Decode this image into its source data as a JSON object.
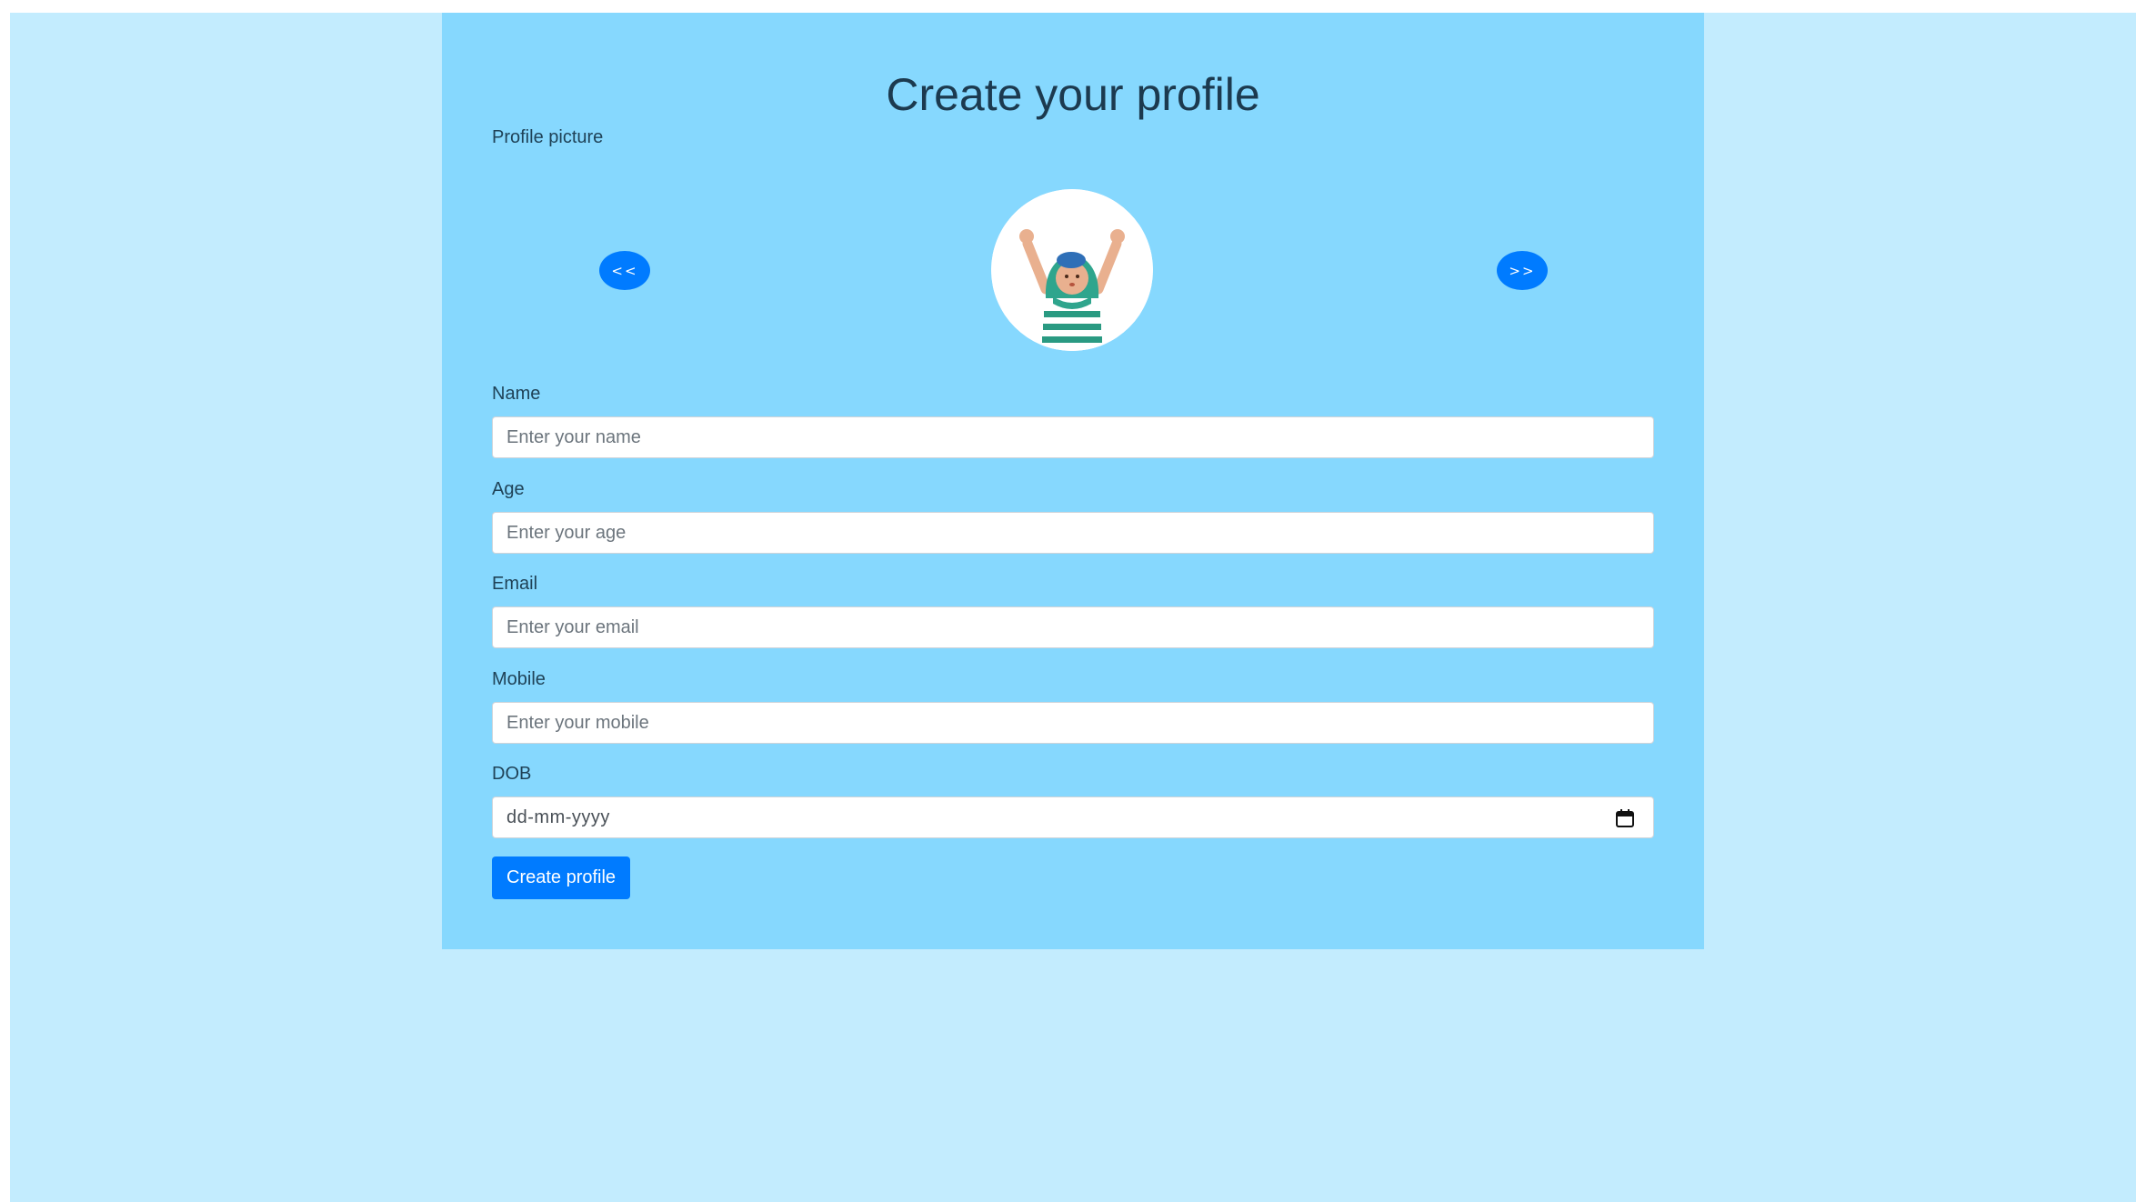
{
  "form": {
    "title": "Create your profile",
    "profile_picture_label": "Profile picture",
    "prev_label": "<<",
    "next_label": ">>",
    "fields": {
      "name": {
        "label": "Name",
        "placeholder": "Enter your name"
      },
      "age": {
        "label": "Age",
        "placeholder": "Enter your age"
      },
      "email": {
        "label": "Email",
        "placeholder": "Enter your email"
      },
      "mobile": {
        "label": "Mobile",
        "placeholder": "Enter your mobile"
      },
      "dob": {
        "label": "DOB",
        "placeholder": "dd-mm-yyyy"
      }
    },
    "submit_label": "Create profile"
  },
  "icons": {
    "avatar": "cheering-person-avatar",
    "calendar": "calendar-icon"
  },
  "colors": {
    "page_background": "#c3ecfe",
    "card_background": "#86d8fe",
    "primary": "#007bff",
    "title_text": "#1c3a4f"
  }
}
